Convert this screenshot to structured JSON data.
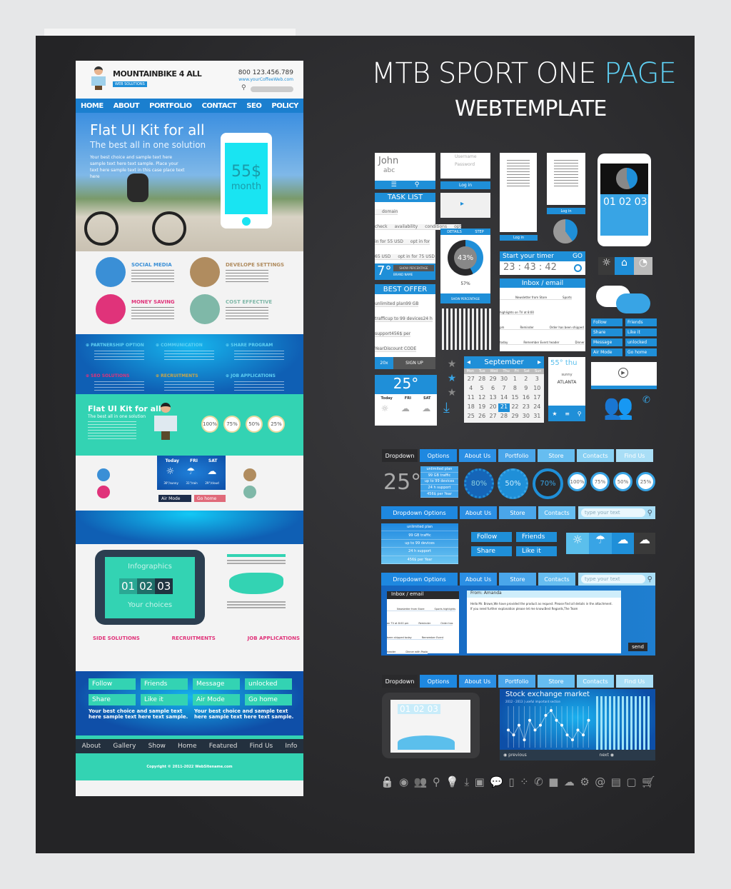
{
  "title": {
    "line1a": "MTB SPORT ONE ",
    "line1b": "PAGE",
    "line2": "WEBTEMPLATE"
  },
  "colors": {
    "accent": "#1f8fd8",
    "light_accent": "#5bbfec",
    "teal": "#33d3b3",
    "panel": "#2b2b2d"
  },
  "left": {
    "logo": "MOUNTAINBIKE 4 ALL",
    "logo_sub": "WEB SOLUTIONS",
    "phone": "800 123.456.789",
    "url": "www.yourCoffeeWeb.com",
    "nav": [
      "HOME",
      "ABOUT",
      "PORTFOLIO",
      "CONTACT",
      "SEO",
      "POLICY"
    ],
    "hero": {
      "title": "Flat UI Kit for all",
      "subtitle": "The best all in one solution",
      "body": "Your best choice and sample text here sample text here text sample. Place your text here sample text in this case place text here",
      "price": "55$",
      "period": "month"
    },
    "features": [
      {
        "title": "SOCIAL MEDIA",
        "color": "#3a8fd6"
      },
      {
        "title": "DEVELOPE SETTINGS",
        "color": "#b08c5f"
      },
      {
        "title": "MONEY SAVING",
        "color": "#e0337a"
      },
      {
        "title": "COST EFFECTIVE",
        "color": "#7fb8a8"
      }
    ],
    "band": [
      "PARTNERSHIP OPTION",
      "COMMUNICATION",
      "SHARE PROGRAM",
      "SEO SOLUTIONS",
      "RECRUITMENTS",
      "JOB APPLICATIONS"
    ],
    "teal": {
      "title": "Flat UI Kit for all",
      "subtitle": "The best all in one solution",
      "percents": [
        "100%",
        "75%",
        "50%",
        "25%"
      ]
    },
    "weather": {
      "days": [
        "Today",
        "FRI",
        "SAT"
      ],
      "temps": [
        "30°/sunny",
        "31°/rain",
        "29°/cloud"
      ]
    },
    "mini_buttons": [
      "Air Mode",
      "Go home"
    ],
    "infographics": {
      "title": "Infographics",
      "nums": [
        "01",
        "02",
        "03"
      ],
      "caption": "Your choices"
    },
    "sections": [
      "SIDE SOLUTIONS",
      "RECRUITMENTS",
      "JOB APPLICATIONS"
    ],
    "buttons": [
      "Follow",
      "Friends",
      "Message",
      "unlocked",
      "Share",
      "Like it",
      "Air Mode",
      "Go home"
    ],
    "sample": "Your best choice and sample text here sample text here text sample.",
    "footer_nav": [
      "About",
      "Gallery",
      "Show",
      "Home",
      "Featured",
      "Find Us",
      "Info"
    ],
    "copyright": "Copyright © 2011-2022 WebSitename.com"
  },
  "right": {
    "john": {
      "name": "John",
      "sub": "abc"
    },
    "login": {
      "user": "Username",
      "pass": "Password",
      "button": "Log in"
    },
    "tasklist": {
      "title": "TASK LIST",
      "items": [
        "domain check",
        "availability",
        "conditions",
        "opt in for 55 USD",
        "opt in for 65 USD",
        "opt in for 75 USD"
      ],
      "temp": "7°",
      "label1": "SHOW PERCENTAGE",
      "label2": "BRAND NAME"
    },
    "offer": {
      "title": "BEST OFFER",
      "items": [
        "unlimited plan",
        "99 GB traffic",
        "up to 99 devices",
        "24 h support",
        "456$ per Year",
        "Discount CODE"
      ],
      "badge": "20x",
      "signup": "SIGN UP"
    },
    "weather25": {
      "temp": "25°",
      "days": [
        "Today",
        "FRI",
        "SAT"
      ]
    },
    "progress": {
      "tab1": "DETAILS",
      "tab2": "STEP",
      "value": "43%",
      "sub": "57%",
      "footer": "SHOW PERCENTAGE"
    },
    "phone": {
      "items": [
        "01",
        "02",
        "03"
      ]
    },
    "timer": {
      "label": "Start your timer",
      "go": "GO",
      "time": "23 : 43 : 42"
    },
    "inbox": {
      "title": "Inbox / email",
      "items": [
        "Newsletter from Store",
        "Sports highlights on TV at 8:00 pm",
        "Reminder",
        "Order has been shipped today",
        "Remember Event header",
        "Dinner with Paolo"
      ]
    },
    "social": [
      "Follow",
      "Friends",
      "Share",
      "Like it",
      "Message",
      "unlocked",
      "Air Mode",
      "Go home"
    ],
    "calendar": {
      "month": "September",
      "days": [
        "Mon",
        "Tue",
        "Wed",
        "Thu",
        "Fri",
        "Sat",
        "Sun"
      ],
      "dates": [
        "27",
        "28",
        "29",
        "30",
        "1",
        "2",
        "3",
        "4",
        "5",
        "6",
        "7",
        "8",
        "9",
        "10",
        "11",
        "12",
        "13",
        "14",
        "15",
        "16",
        "17",
        "18",
        "19",
        "20",
        "21",
        "22",
        "23",
        "24",
        "25",
        "26",
        "27",
        "28",
        "29",
        "30",
        "31"
      ],
      "selected": "21"
    },
    "city": {
      "temp": "55° thu",
      "cond": "sunny",
      "name": "ATLANTA"
    },
    "tabs1": [
      "Dropdown",
      "Options",
      "About Us",
      "Portfolio",
      "Store",
      "Contacts",
      "Find Us"
    ],
    "temp25": "25°",
    "drop_items": [
      "unlimited plan",
      "99 GB traffic",
      "up to 99 devices",
      "24 h support",
      "456$ per Year"
    ],
    "rings": [
      "80%",
      "50%",
      "70%"
    ],
    "circles": [
      "100%",
      "75%",
      "50%",
      "25%"
    ],
    "tabs2": [
      "Dropdown Options",
      "About Us",
      "Store",
      "Contacts"
    ],
    "search_placeholder": "type your text",
    "btns2": [
      "Follow",
      "Friends",
      "Share",
      "Like it"
    ],
    "email": {
      "title": "Inbox / email",
      "items": [
        "Newsletter from Store",
        "Sports highlights on TV at 8:00 pm",
        "Reminder",
        "Order has been shipped today",
        "Remember Event header",
        "Dinner with Paolo"
      ],
      "from": "From: Amanda",
      "body": [
        "Hello Mr. Brown,",
        "We have provided the product as request. Please find all details in the attachment. If you need further explanation please let me know.",
        "Best Regards,",
        "The Team"
      ],
      "send": "send"
    },
    "tabs3": [
      "Dropdown",
      "Options",
      "About Us",
      "Portfolio",
      "Store",
      "Contacts",
      "Find Us"
    ],
    "tablet2": {
      "nums": [
        "01",
        "02",
        "03"
      ]
    },
    "stock": {
      "title": "Stock exchange market",
      "sub": "2012 - 2013 | useful important section",
      "prev": "previous",
      "next": "next",
      "points": [
        3,
        2,
        4,
        1,
        5,
        3,
        4,
        6,
        7,
        5,
        4,
        2,
        1,
        3,
        2,
        5
      ]
    },
    "bottom_icons": [
      "lock-icon",
      "mouse-icon",
      "users-icon",
      "search-icon",
      "bulb-icon",
      "download-icon",
      "contact-icon",
      "chat-icon",
      "mobile-icon",
      "network-icon",
      "phone-icon",
      "camera-icon",
      "cloud-icon",
      "gears-icon",
      "at-icon",
      "cards-icon",
      "tablet-icon",
      "cart-icon"
    ]
  }
}
